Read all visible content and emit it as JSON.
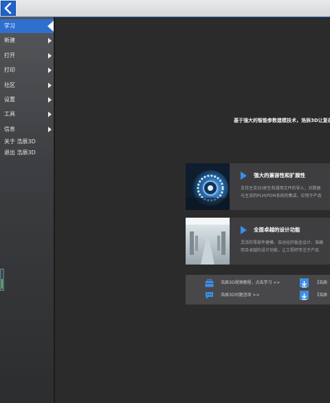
{
  "topbar": {
    "back_icon": "back-arrow-icon"
  },
  "sidebar": {
    "items": [
      {
        "label": "学习",
        "active": true
      },
      {
        "label": "新建"
      },
      {
        "label": "打开"
      },
      {
        "label": "打印"
      },
      {
        "label": "社区"
      },
      {
        "label": "设置"
      },
      {
        "label": "工具"
      },
      {
        "label": "信息"
      },
      {
        "label": "关于 浩辰3D"
      },
      {
        "label": "退出 浩辰3D"
      }
    ]
  },
  "main": {
    "subtitle": "基于强大的智能参数建模技术，浩辰3D让复杂设",
    "cards": [
      {
        "title": "强大的兼容性和扩展性",
        "desc_lines": [
          "支持主流3D原生和通用文件的导入，对数据",
          "与主流的PLM/PDM系统的集成，应用于产品"
        ]
      },
      {
        "title": "全面卓越的设计功能",
        "desc_lines": [
          "灵活的零部件建模、自动化的钣金设计、准确",
          "而且卓越的设计功能，让工程师专注于产品"
        ]
      }
    ],
    "links": [
      {
        "icon": "briefcase-icon",
        "text": "浩辰3D视频教程，点击学习 >>",
        "download_text": "【浩辰"
      },
      {
        "icon": "chat-bubble-icon",
        "text": "浩辰3D问题咨询 >>",
        "download_text": "【浩辰"
      }
    ]
  },
  "colors": {
    "accent": "#2f6fd0",
    "play": "#3a8fe8",
    "background": "#2b2b2b"
  }
}
